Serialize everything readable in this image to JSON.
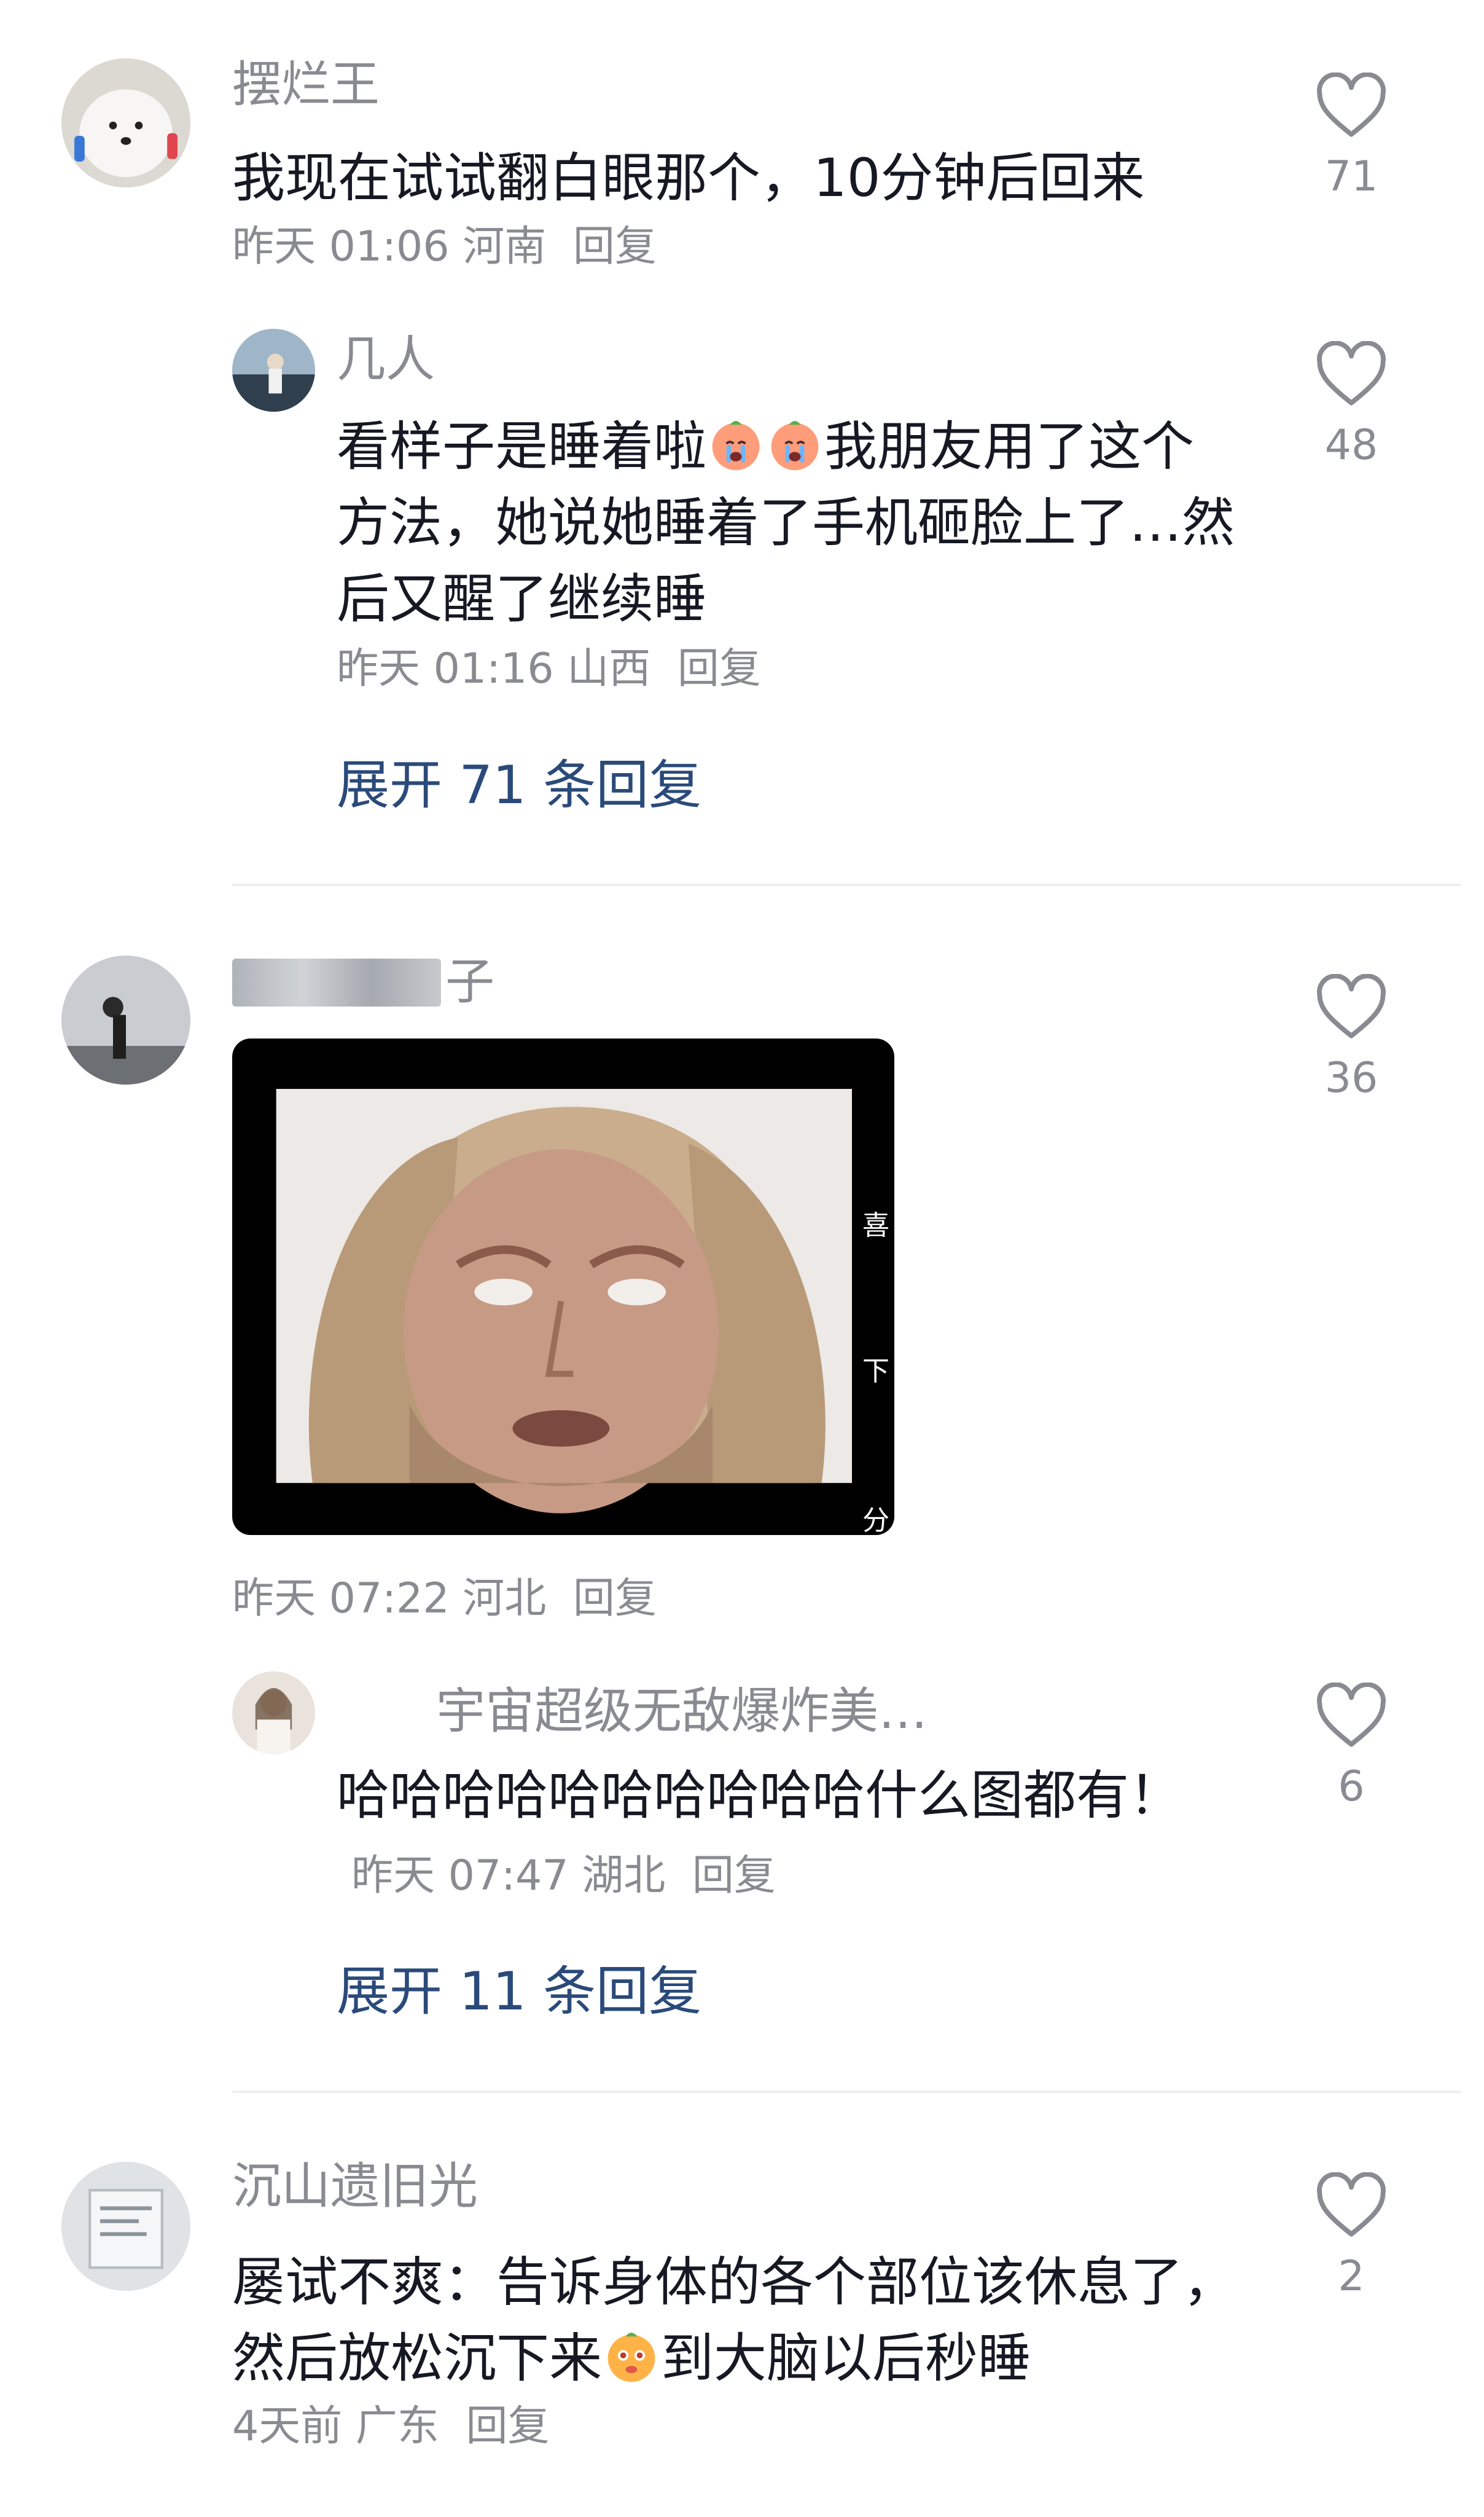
{
  "comments": [
    {
      "username": "摆烂王",
      "text": "我现在试试翻白眼那个，10分钟后回来",
      "time": "昨天 01:06",
      "location": "河南",
      "reply_label": "回复",
      "likes": "71",
      "replies": [
        {
          "username": "几人",
          "text_part1": "看样子是睡着啦",
          "emoji": "crying-peach-emoji",
          "text_part2": "我朋友用了这个方法，她说她睡着了手机砸脸上了…然后又醒了继续睡",
          "time": "昨天 01:16",
          "location": "山西",
          "reply_label": "回复",
          "likes": "48"
        }
      ],
      "expand_label": "展开 71 条回复"
    },
    {
      "username_visible_suffix": "子",
      "image_caption": "video-meme-screenshot",
      "image_side_labels": [
        "喜",
        "下",
        "分"
      ],
      "time": "昨天 07:22",
      "location": "河北",
      "reply_label": "回复",
      "likes": "36",
      "replies": [
        {
          "username": "宇宙超级无敌爆炸美…",
          "text": "哈哈哈哈哈哈哈哈哈哈什么图都有！",
          "time": "昨天 07:47",
          "location": "湖北",
          "reply_label": "回复",
          "likes": "6"
        }
      ],
      "expand_label": "展开 11 条回复"
    },
    {
      "username": "沉山遗旧光",
      "text_part1": "屡试不爽：告诉身体的各个部位该休息了，然后放松沉下来",
      "emoji": "peach-face-emoji",
      "text_part2": "到大脑以后秒睡",
      "time": "4天前",
      "location": "广东",
      "reply_label": "回复",
      "likes": "2"
    }
  ],
  "colors": {
    "text": "#161823",
    "meta": "#8a8b91",
    "link": "#2a4a7a",
    "divider": "#efeff0"
  },
  "icons": {
    "like": "heart-outline-icon"
  }
}
